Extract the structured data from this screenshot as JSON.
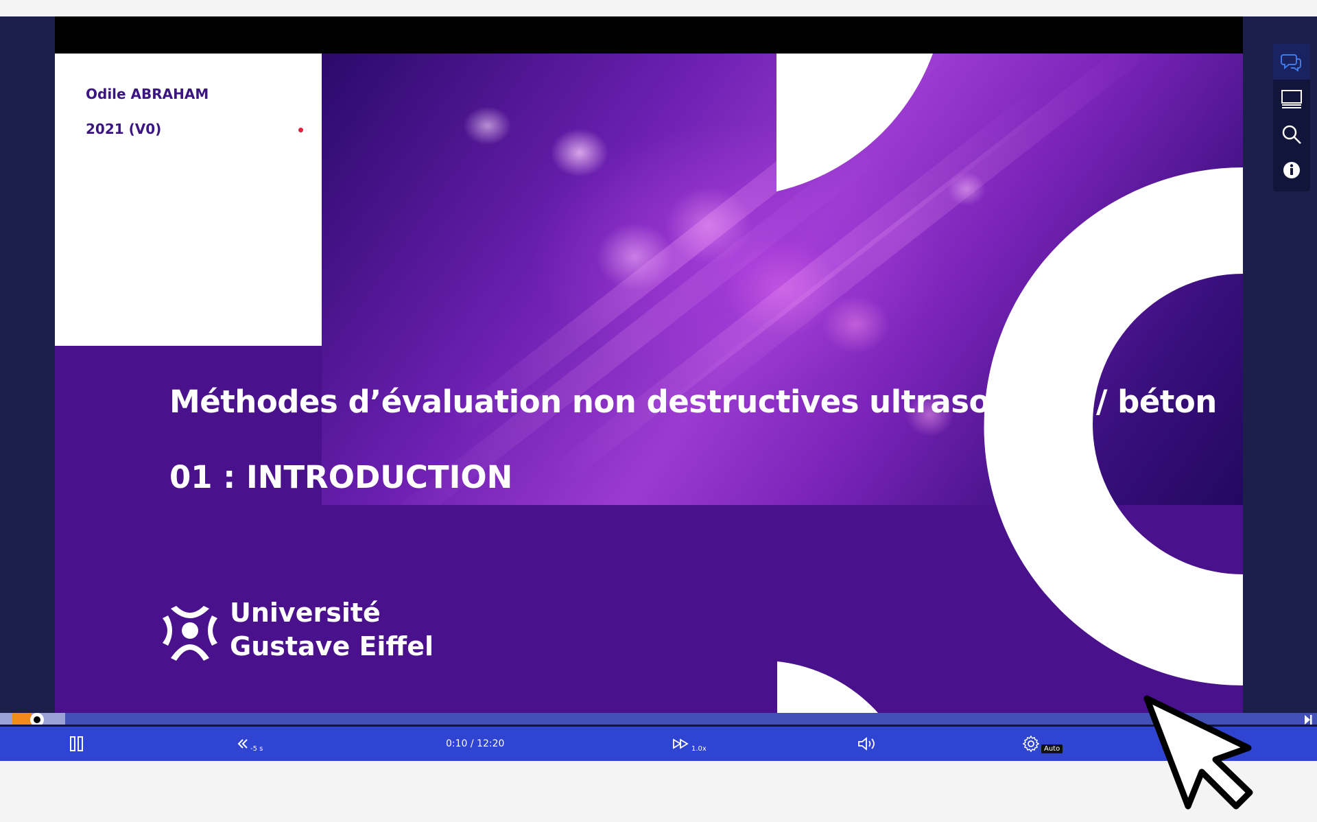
{
  "slide": {
    "author": "Odile ABRAHAM",
    "year": "2021 (V0)",
    "title": "Méthodes d’évaluation non destructives ultrasonores / béton",
    "subtitle": "01 : INTRODUCTION",
    "logo": {
      "line1": "Université",
      "line2": "Gustave Eiffel"
    }
  },
  "right_tools": [
    {
      "name": "comments-icon",
      "active": true
    },
    {
      "name": "slides-icon",
      "active": false
    },
    {
      "name": "search-icon",
      "active": false
    },
    {
      "name": "info-icon",
      "active": false
    }
  ],
  "player": {
    "progress_fraction": 0.0135,
    "controls": {
      "rewind_label": "-5 s",
      "time": "0:10 / 12:20",
      "speed_label": "1.0x",
      "quality_label": "Auto"
    }
  },
  "colors": {
    "accent": "#2f44d0",
    "slide_purple": "#4a118d",
    "played": "#f28a1c",
    "author_text": "#3b1580"
  }
}
